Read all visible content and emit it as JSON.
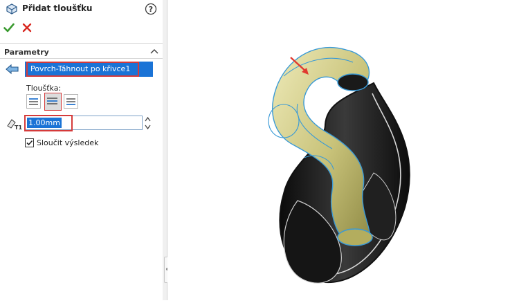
{
  "panel": {
    "title": "Přidat tloušťku",
    "section_title": "Parametry",
    "surface_value": "Povrch-Táhnout po křivce1",
    "thickness_label": "Tloušťka:",
    "thickness_value": "1.00mm",
    "merge_label": "Sloučit výsledek",
    "merge_checked": true,
    "thickness_spin_label": "T1"
  },
  "colors": {
    "accept": "#3a9a2f",
    "cancel": "#d8261f",
    "selection": "#1a73d6",
    "highlight": "#d53a3a",
    "surface": "#d6d38f",
    "body": "#1c1c1c"
  }
}
